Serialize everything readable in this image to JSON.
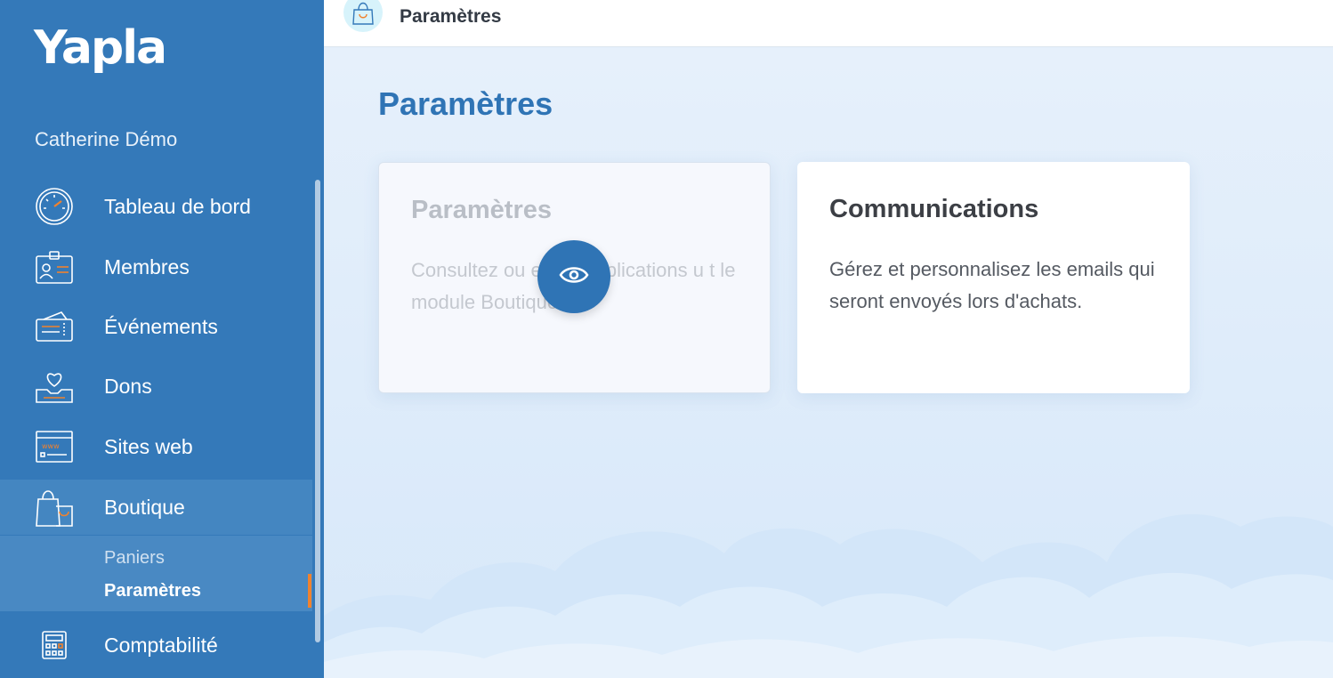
{
  "brand": {
    "logo_text": "Yapla"
  },
  "user": {
    "name": "Catherine Démo"
  },
  "sidebar": {
    "items": [
      {
        "label": "Tableau de bord",
        "icon": "dashboard-gauge-icon"
      },
      {
        "label": "Membres",
        "icon": "member-card-icon"
      },
      {
        "label": "Événements",
        "icon": "ticket-icon"
      },
      {
        "label": "Dons",
        "icon": "heart-box-icon"
      },
      {
        "label": "Sites web",
        "icon": "website-icon"
      },
      {
        "label": "Boutique",
        "icon": "shopping-bag-icon"
      },
      {
        "label": "Comptabilité",
        "icon": "calculator-icon"
      }
    ],
    "submenu": [
      {
        "label": "Paniers"
      },
      {
        "label": "Paramètres"
      }
    ]
  },
  "topbar": {
    "title": "Paramètres",
    "icon": "shopping-bag-icon"
  },
  "main": {
    "title": "Paramètres",
    "cards": [
      {
        "title": "Paramètres",
        "text": "Consultez ou     er les applications u        t le module Boutique."
      },
      {
        "title": "Communications",
        "text": "Gérez et personnalisez les emails qui seront envoyés lors d'achats."
      }
    ]
  },
  "colors": {
    "primary": "#3479b9",
    "accent": "#f0822e",
    "title_blue": "#2f74b5"
  }
}
